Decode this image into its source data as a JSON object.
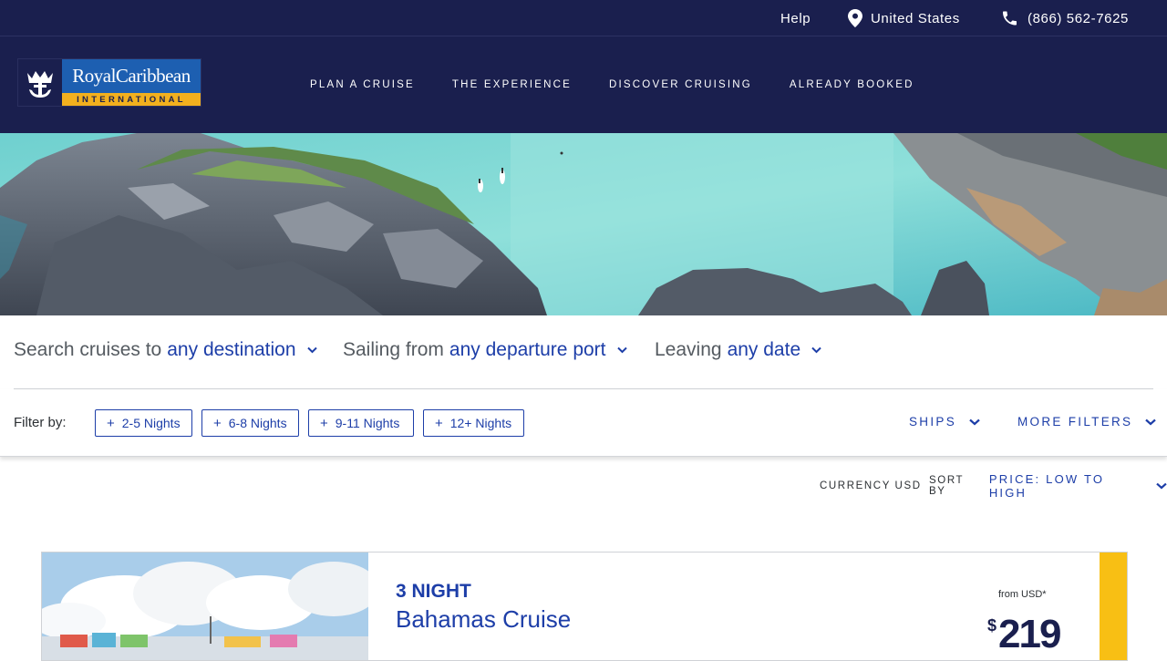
{
  "utility": {
    "help": "Help",
    "country": "United States",
    "phone": "(866) 562-7625"
  },
  "brand": {
    "name": "RoyalCaribbean",
    "tagline": "INTERNATIONAL"
  },
  "nav": {
    "items": [
      {
        "label": "PLAN A CRUISE"
      },
      {
        "label": "THE EXPERIENCE"
      },
      {
        "label": "DISCOVER CRUISING"
      },
      {
        "label": "ALREADY BOOKED"
      }
    ]
  },
  "search": {
    "destination": {
      "prefix": "Search cruises to",
      "value": "any destination"
    },
    "port": {
      "prefix": "Sailing from",
      "value": "any departure port"
    },
    "date": {
      "prefix": "Leaving",
      "value": "any date"
    }
  },
  "filters": {
    "label": "Filter by:",
    "chips": [
      {
        "label": "2-5 Nights"
      },
      {
        "label": "6-8 Nights"
      },
      {
        "label": "9-11 Nights"
      },
      {
        "label": "12+ Nights"
      }
    ],
    "ships": "SHIPS",
    "more": "MORE FILTERS"
  },
  "sort": {
    "currency": "CURRENCY USD",
    "sort_label": "SORT BY",
    "sort_value": "PRICE: LOW TO HIGH"
  },
  "results": [
    {
      "nights": "3 NIGHT",
      "name": "Bahamas Cruise",
      "from_label": "from USD*",
      "currency_symbol": "$",
      "price": "219"
    }
  ],
  "colors": {
    "navy": "#1a1f4e",
    "link_blue": "#1d3ea8",
    "gold": "#f8bf14",
    "brand_blue": "#1d5fb1"
  }
}
